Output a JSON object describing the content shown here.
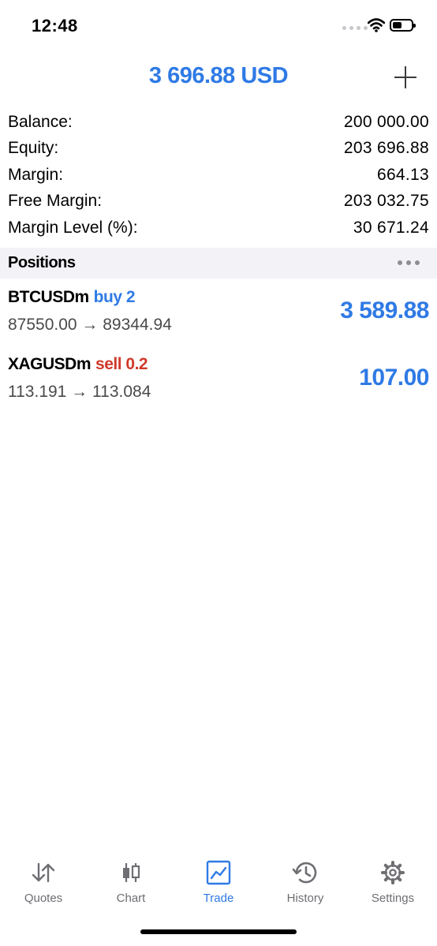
{
  "status": {
    "time": "12:48"
  },
  "header": {
    "title": "3 696.88 USD",
    "add_icon": "plus-icon"
  },
  "summary": [
    {
      "label": "Balance:",
      "value": "200 000.00"
    },
    {
      "label": "Equity:",
      "value": "203 696.88"
    },
    {
      "label": "Margin:",
      "value": "664.13"
    },
    {
      "label": "Free Margin:",
      "value": "203 032.75"
    },
    {
      "label": "Margin Level (%):",
      "value": "30 671.24"
    }
  ],
  "positions_section": {
    "title": "Positions",
    "more_icon": "more-dots-icon"
  },
  "positions": [
    {
      "symbol": "BTCUSDm",
      "side": "buy 2",
      "prices": "87550.00 → 89344.94",
      "profit": "3 589.88",
      "side_color": "#2f7ae5"
    },
    {
      "symbol": "XAGUSDm",
      "side": "sell 0.2",
      "prices": "113.191 → 113.084",
      "profit": "107.00",
      "side_color": "#d0392b"
    }
  ],
  "tabs": [
    {
      "label": "Quotes",
      "icon": "quotes-arrows-icon",
      "active": false
    },
    {
      "label": "Chart",
      "icon": "candlestick-chart-icon",
      "active": false
    },
    {
      "label": "Trade",
      "icon": "trade-chart-icon",
      "active": true
    },
    {
      "label": "History",
      "icon": "history-clock-icon",
      "active": false
    },
    {
      "label": "Settings",
      "icon": "gear-icon",
      "active": false
    }
  ],
  "colors": {
    "accent": "#2f7ae5",
    "sell": "#d0392b",
    "section_bg": "#f2f2f7"
  }
}
